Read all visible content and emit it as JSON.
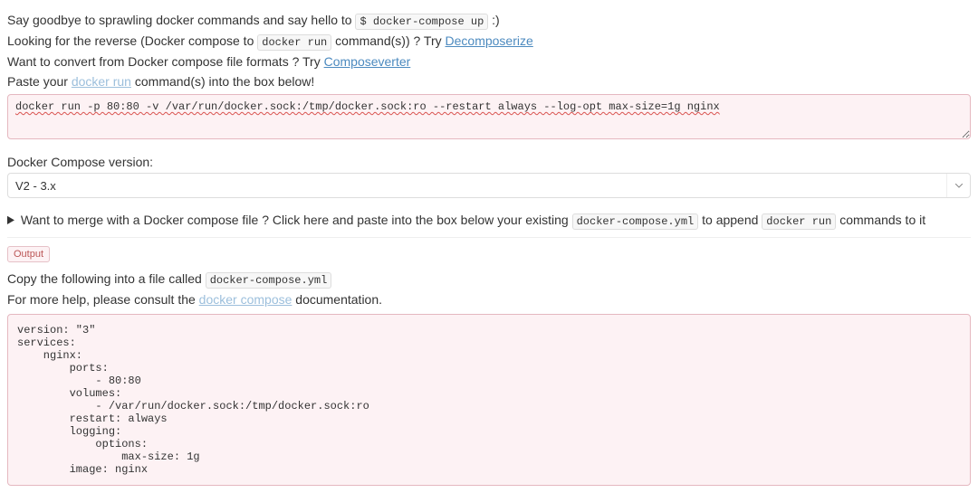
{
  "intro": {
    "goodbye_pre": "Say goodbye to sprawling docker commands and say hello to ",
    "goodbye_code": "$ docker-compose up",
    "goodbye_post": " :)",
    "reverse_pre": "Looking for the reverse (Docker compose to ",
    "reverse_code": "docker run",
    "reverse_post": " command(s)) ? Try ",
    "reverse_link": "Decomposerize",
    "convert_pre": "Want to convert from Docker compose file formats ? Try ",
    "convert_link": "Composeverter",
    "paste_pre": "Paste your ",
    "paste_link": "docker run",
    "paste_post": " command(s) into the box below!"
  },
  "input": {
    "value": "docker run -p 80:80 -v /var/run/docker.sock:/tmp/docker.sock:ro --restart always --log-opt max-size=1g nginx"
  },
  "version": {
    "label": "Docker Compose version:",
    "selected": "V2 - 3.x"
  },
  "merge": {
    "summary_pre": "Want to merge with a Docker compose file ? Click here and paste into the box below your existing ",
    "summary_code1": "docker-compose.yml",
    "summary_mid": " to append ",
    "summary_code2": "docker run",
    "summary_post": " commands to it"
  },
  "tabs": {
    "output": "Output"
  },
  "copy": {
    "pre": "Copy the following into a file called ",
    "code": "docker-compose.yml"
  },
  "help": {
    "pre": "For more help, please consult the ",
    "link": "docker compose",
    "post": " documentation."
  },
  "output_yaml": "version: \"3\"\nservices:\n    nginx:\n        ports:\n            - 80:80\n        volumes:\n            - /var/run/docker.sock:/tmp/docker.sock:ro\n        restart: always\n        logging:\n            options:\n                max-size: 1g\n        image: nginx"
}
